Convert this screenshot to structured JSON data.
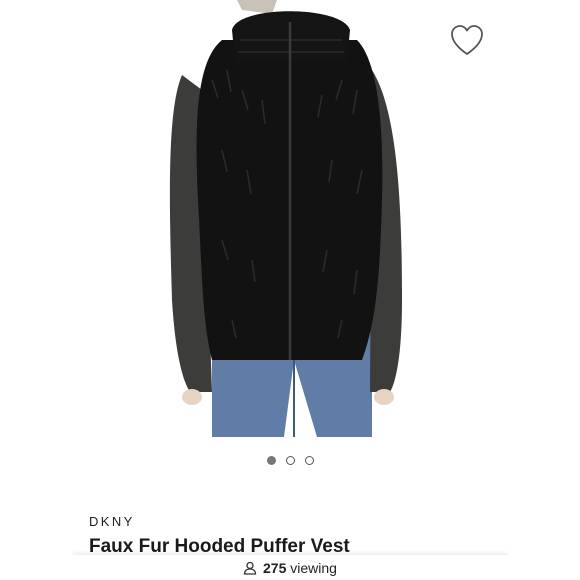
{
  "product": {
    "brand": "DKNY",
    "title": "Faux Fur Hooded Puffer Vest",
    "image_alt_icon": "product-photo",
    "favorite_icon": "heart-icon"
  },
  "carousel": {
    "count": 3,
    "active_index": 0
  },
  "viewing": {
    "count": "275",
    "label": "viewing",
    "icon": "person-icon"
  },
  "colors": {
    "background": "#ffffff",
    "text": "#1a1a1a"
  }
}
